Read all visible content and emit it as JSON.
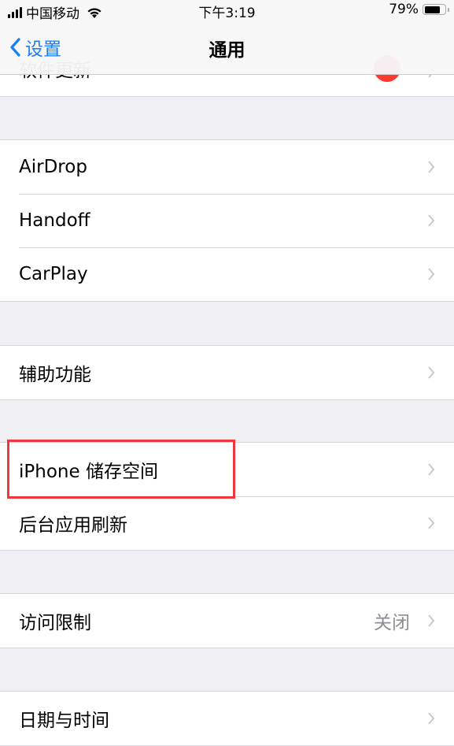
{
  "status_bar": {
    "carrier": "中国移动",
    "time": "下午3:19",
    "battery_percent": "79%",
    "battery_level": 0.79,
    "signal_icon": "signal-bars-icon",
    "wifi_icon": "wifi-icon"
  },
  "nav": {
    "back_label": "设置",
    "title": "通用"
  },
  "partial_top_row": {
    "label": "软件更新",
    "badge_color": "#fe3b30"
  },
  "groups": [
    {
      "rows": [
        {
          "label": "AirDrop"
        },
        {
          "label": "Handoff"
        },
        {
          "label": "CarPlay"
        }
      ]
    },
    {
      "rows": [
        {
          "label": "辅助功能"
        }
      ]
    },
    {
      "rows": [
        {
          "label": "iPhone 储存空间",
          "highlighted": true
        },
        {
          "label": "后台应用刷新"
        }
      ]
    },
    {
      "rows": [
        {
          "label": "访问限制",
          "detail": "关闭"
        }
      ]
    },
    {
      "rows": [
        {
          "label": "日期与时间"
        }
      ]
    }
  ],
  "colors": {
    "accent": "#1a7ef5",
    "highlight_box": "#f0373f",
    "background": "#efeff4"
  }
}
